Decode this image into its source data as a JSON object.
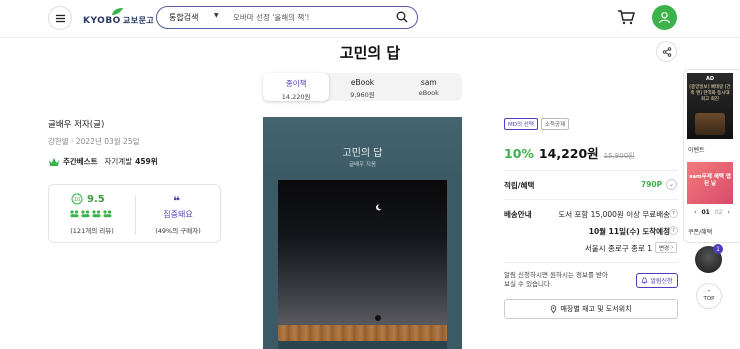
{
  "header": {
    "logo_text": "KYOBO",
    "logo_kr": "교보문고",
    "search_category": "통합검색",
    "search_placeholder": "오바마 선정 '올해의 책'!"
  },
  "product": {
    "title": "고민의 답",
    "formats": [
      {
        "name": "종이책",
        "price": "14,220원"
      },
      {
        "name": "eBook",
        "price": "9,960원"
      },
      {
        "name": "sam",
        "price": "eBook"
      }
    ],
    "author": "글배우 저자(글)",
    "pubinfo": "강한별 · 2022년 03월 25일",
    "bestseller_label": "주간베스트",
    "bestseller_category": "자기계발",
    "bestseller_rank": "459위",
    "review": {
      "score": "9.5",
      "count": "(121개의 리뷰)",
      "keyword": "집중돼요",
      "buyer_ratio": "(49%의 구매자)"
    },
    "cover": {
      "title": "고민의 답",
      "subtitle": "글배우 지음"
    },
    "badges": [
      "MD의 선택",
      "소득공제"
    ],
    "discount": "10%",
    "price": "14,220원",
    "original_price": "15,800원",
    "points_label": "적립/혜택",
    "points": "790P",
    "shipping_label": "배송안내",
    "shipping_free": "도서 포함 15,000원 이상 무료배송",
    "delivery_date": "10월 11일(수) 도착예정",
    "location": "서울시 종로구 종로 1",
    "change_label": "변경",
    "notify_text": "알림 신청하시면 원하시는 정보를 받아 보실 수 있습니다.",
    "notify_button": "알림신청",
    "store_button": "매장별 재고 및 도서위치"
  },
  "side": {
    "ad_label": "AD",
    "ad_text": "[중앙일보] 베테랑 [건축 앤] 한역화 등시대 회고 회진",
    "event_label": "이벤트",
    "sam_text": "sam무제 혜택 앱된 날",
    "pager_current": "01",
    "pager_total": "02",
    "coupon_label": "쿠폰/혜택",
    "recent_count": "1",
    "top_label": "TOP"
  },
  "colors": {
    "brand_green": "#3bb34a",
    "accent_purple": "#4b3dbb"
  }
}
